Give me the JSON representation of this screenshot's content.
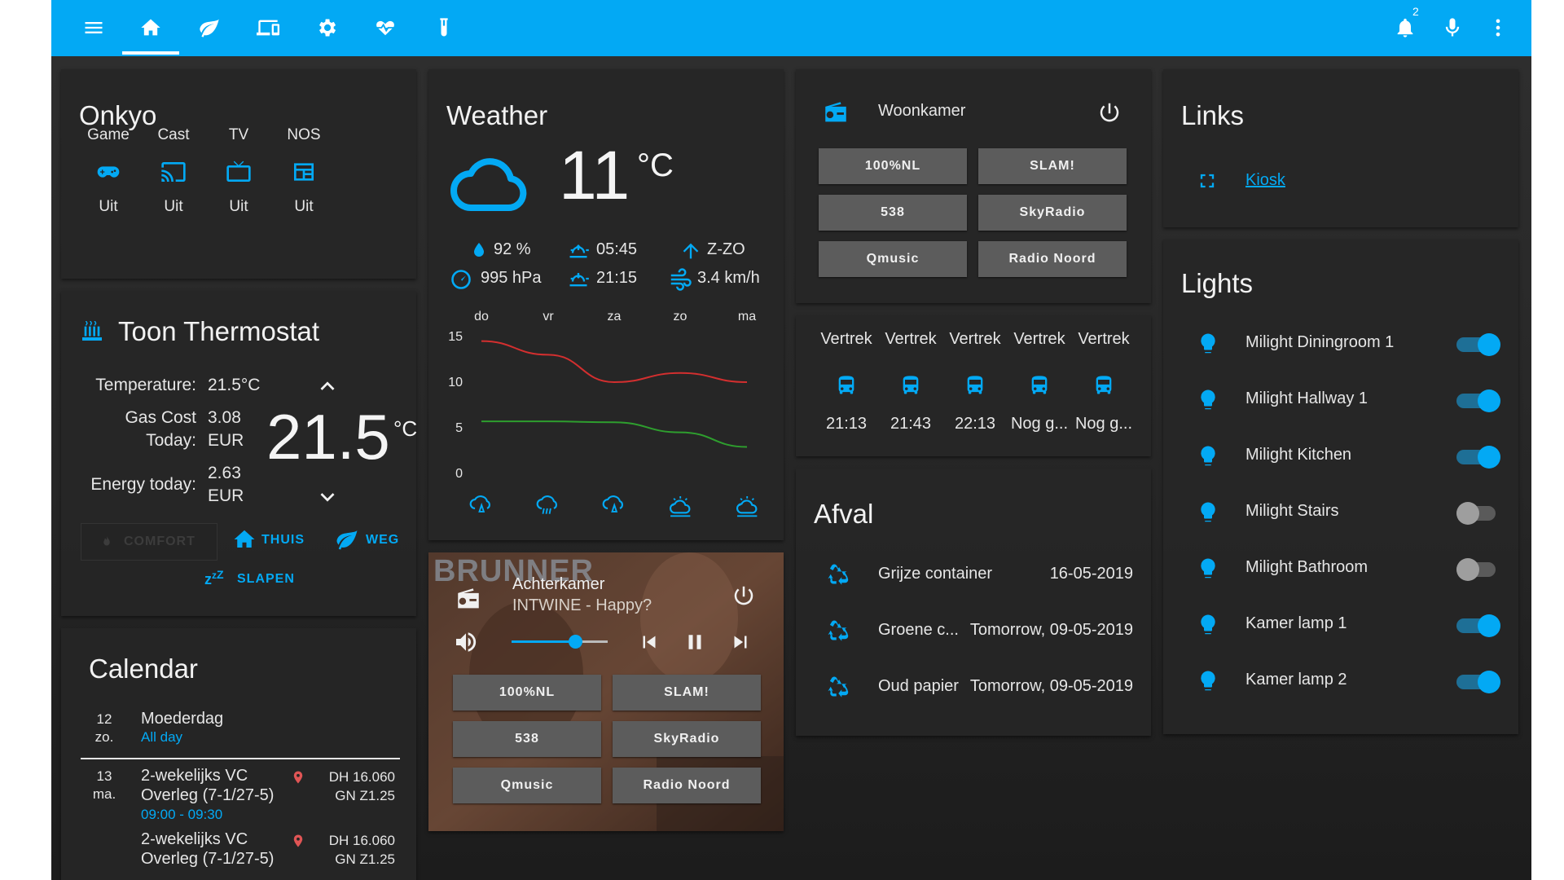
{
  "colors": {
    "accent": "#03a9f4",
    "card": "#262626",
    "text": "#e6e6e6",
    "temp_high": "#d32f2f",
    "temp_low": "#2e9e2e"
  },
  "topbar": {
    "icons": [
      "menu-icon",
      "home-icon",
      "leaf-icon",
      "devices-icon",
      "gear-icon",
      "heart-pulse-icon",
      "test-tube-icon"
    ],
    "notifications_count": "2"
  },
  "onkyo": {
    "title": "Onkyo",
    "sources": [
      {
        "label": "Game",
        "state": "Uit",
        "icon": "gamepad-icon"
      },
      {
        "label": "Cast",
        "state": "Uit",
        "icon": "cast-icon"
      },
      {
        "label": "TV",
        "state": "Uit",
        "icon": "tv-icon"
      },
      {
        "label": "NOS",
        "state": "Uit",
        "icon": "teletext-icon"
      }
    ]
  },
  "thermostat": {
    "title": "Toon Thermostat",
    "temperature_label": "Temperature:",
    "temperature_value": "21.5°C",
    "gas_label_1": "Gas Cost",
    "gas_label_2": "Today:",
    "gas_value_1": "3.08",
    "gas_value_2": "EUR",
    "energy_label": "Energy today:",
    "energy_value_1": "2.63",
    "energy_value_2": "EUR",
    "setpoint": "21.5",
    "unit": "°C",
    "presets": {
      "comfort": "COMFORT",
      "thuis": "THUIS",
      "weg": "WEG",
      "slapen": "SLAPEN"
    }
  },
  "calendar": {
    "title": "Calendar",
    "events": [
      {
        "day": "12",
        "dow": "zo.",
        "title": "Moederdag",
        "time": "All day",
        "location_1": "",
        "location_2": ""
      },
      {
        "day": "13",
        "dow": "ma.",
        "title_1": "2-wekelijks VC",
        "title_2": "Overleg (7-1/27-5)",
        "time": "09:00 - 09:30",
        "location_1": "DH 16.060",
        "location_2": "GN Z1.25"
      },
      {
        "title_1": "2-wekelijks VC",
        "title_2": "Overleg (7-1/27-5)",
        "location_1": "DH 16.060",
        "location_2": "GN Z1.25"
      }
    ]
  },
  "weather": {
    "title": "Weather",
    "temperature": "11",
    "unit": "°C",
    "humidity": "92 %",
    "pressure": "995 hPa",
    "sunrise": "05:45",
    "sunset": "21:15",
    "wind_dir": "Z-ZO",
    "wind_speed": "3.4 km/h",
    "days": [
      "do",
      "vr",
      "za",
      "zo",
      "ma"
    ],
    "forecast_icons": [
      "rain-icon",
      "pouring-icon",
      "rain-icon",
      "partly-cloudy-sun-icon",
      "partly-cloudy-sun-icon"
    ]
  },
  "chart_data": {
    "type": "line",
    "x": [
      "do",
      "vr",
      "za",
      "zo",
      "ma"
    ],
    "series": [
      {
        "values": [
          14.5,
          13,
          10,
          11,
          10
        ],
        "color": "#d32f2f"
      },
      {
        "values": [
          5.7,
          5.7,
          5.6,
          4.5,
          2.9
        ],
        "color": "#2e9e2e"
      }
    ],
    "y_ticks": [
      "15",
      "10",
      "5",
      "0"
    ],
    "ylim": [
      0,
      15
    ],
    "xlabel": "",
    "ylabel": "",
    "title": "",
    "grid": false
  },
  "woonkamer": {
    "title": "Woonkamer",
    "buttons": [
      "100%NL",
      "SLAM!",
      "538",
      "SkyRadio",
      "Qmusic",
      "Radio Noord"
    ]
  },
  "vertrek": {
    "items": [
      {
        "label": "Vertrek",
        "time": "21:13"
      },
      {
        "label": "Vertrek",
        "time": "21:43"
      },
      {
        "label": "Vertrek",
        "time": "22:13"
      },
      {
        "label": "Vertrek",
        "time": "Nog g..."
      },
      {
        "label": "Vertrek",
        "time": "Nog g..."
      }
    ]
  },
  "afval": {
    "title": "Afval",
    "items": [
      {
        "name": "Grijze container",
        "date": "16-05-2019"
      },
      {
        "name": "Groene c...",
        "date": "Tomorrow, 09-05-2019"
      },
      {
        "name": "Oud papier",
        "date": "Tomorrow, 09-05-2019"
      }
    ]
  },
  "player": {
    "room": "Achterkamer",
    "track": "INTWINE - Happy?",
    "art_text": "BRUNNER",
    "volume": 0.66,
    "buttons": [
      "100%NL",
      "SLAM!",
      "538",
      "SkyRadio",
      "Qmusic",
      "Radio Noord"
    ]
  },
  "links": {
    "title": "Links",
    "items": [
      {
        "label": "Kiosk"
      }
    ]
  },
  "lights": {
    "title": "Lights",
    "items": [
      {
        "name": "Milight Diningroom 1",
        "on": true
      },
      {
        "name": "Milight Hallway 1",
        "on": true
      },
      {
        "name": "Milight Kitchen",
        "on": true
      },
      {
        "name": "Milight Stairs",
        "on": false
      },
      {
        "name": "Milight Bathroom",
        "on": false
      },
      {
        "name": "Kamer lamp 1",
        "on": true
      },
      {
        "name": "Kamer lamp 2",
        "on": true
      }
    ]
  }
}
